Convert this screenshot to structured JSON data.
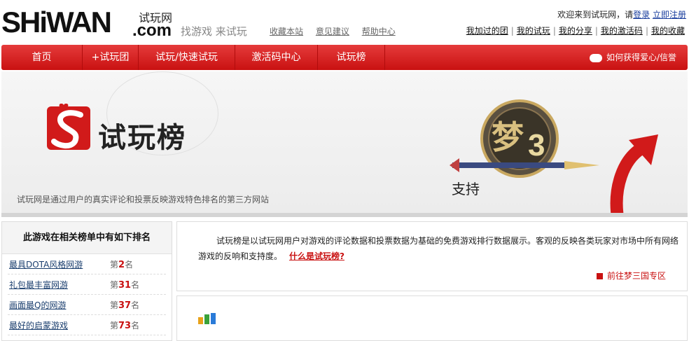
{
  "header": {
    "logo_text": "SHiWAN",
    "logo_sub": "试玩网",
    "logo_domain": ".com",
    "slogan": "找游戏 来试玩",
    "top_links": [
      "收藏本站",
      "意见建议",
      "帮助中心"
    ],
    "welcome_text": "欢迎来到试玩网，请",
    "login_label": "登录",
    "register_label": "立即注册",
    "user_links": [
      "我加过的团",
      "我的试玩",
      "我的分享",
      "我的激活码",
      "我的收藏"
    ]
  },
  "nav": {
    "items": [
      "首页",
      "+试玩团",
      "试玩/快速试玩",
      "激活码中心",
      "试玩榜"
    ],
    "help_label": "如何获得爱心/信誉"
  },
  "banner": {
    "title": "试玩榜",
    "description": "试玩网是通过用户的真实评论和投票反映游戏特色排名的第三方网站",
    "game_name": "梦三国",
    "support_label": "支持",
    "colors": {
      "brand_red": "#c91111"
    }
  },
  "left_panel": {
    "heading": "此游戏在相关榜单中有如下排名",
    "rankings": [
      {
        "name": "最具DOTA风格网游",
        "prefix": "第",
        "rank": "2",
        "suffix": "名"
      },
      {
        "name": "礼包最丰富网游",
        "prefix": "第",
        "rank": "31",
        "suffix": "名"
      },
      {
        "name": "画面最Q的网游",
        "prefix": "第",
        "rank": "37",
        "suffix": "名"
      },
      {
        "name": "最好的启蒙游戏",
        "prefix": "第",
        "rank": "73",
        "suffix": "名"
      }
    ]
  },
  "info": {
    "text": "试玩榜是以试玩网用户对游戏的评论数据和投票数据为基础的免费游戏排行数据展示。客观的反映各类玩家对市场中所有网络游戏的反响和支持度。",
    "link_label": "什么是试玩榜?",
    "goto_label": "前往梦三国专区"
  }
}
